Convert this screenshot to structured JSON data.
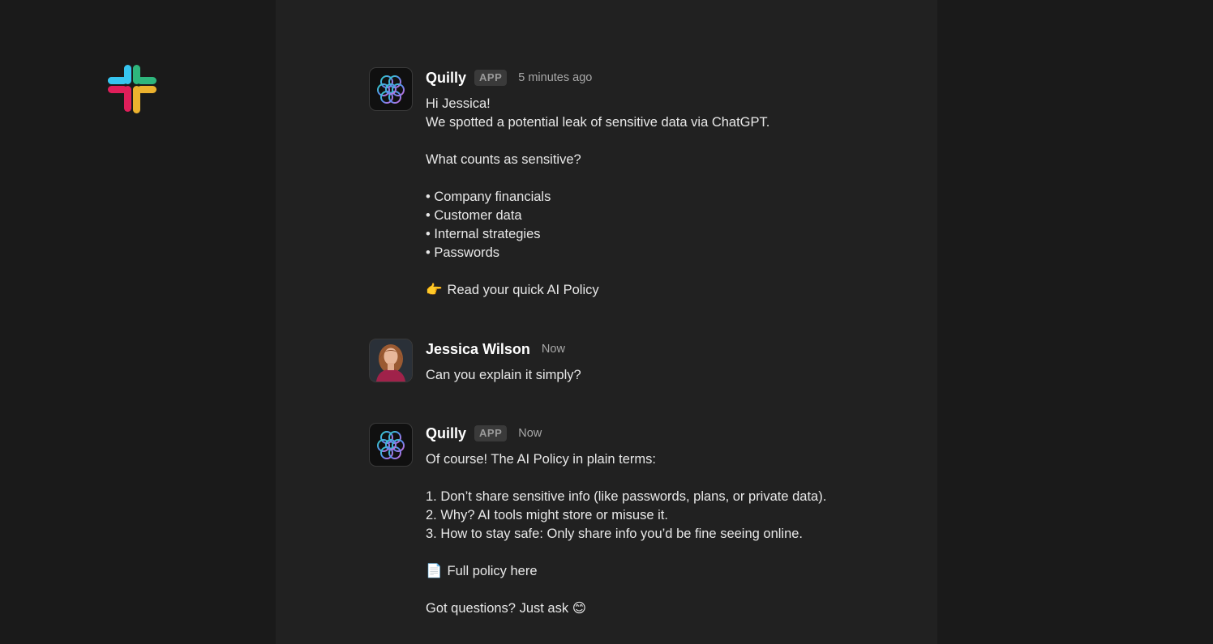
{
  "brand": {
    "logo": "slack-logo",
    "colors": {
      "blue": "#36c5f0",
      "green": "#2eb67d",
      "yellow": "#ecb22e",
      "red": "#e01e5a"
    }
  },
  "messages": [
    {
      "sender": "Quilly",
      "badge": "APP",
      "time": "5 minutes ago",
      "avatar": "quilly-logo",
      "lines": {
        "l1": "Hi Jessica!",
        "l2": "We spotted a potential leak of sensitive data via ChatGPT.",
        "l3": "What counts as sensitive?",
        "l4": "• Company financials",
        "l5": "• Customer data",
        "l6": "• Internal strategies",
        "l7": "• Passwords",
        "l8_emoji": "👉",
        "l8_text": "Read your quick AI Policy"
      }
    },
    {
      "sender": "Jessica Wilson",
      "time": "Now",
      "avatar": "user-photo",
      "lines": {
        "l1": "Can you explain it simply?"
      }
    },
    {
      "sender": "Quilly",
      "badge": "APP",
      "time": "Now",
      "avatar": "quilly-logo",
      "lines": {
        "l1": "Of course! The AI Policy in plain terms:",
        "l2": "1. Don’t share sensitive info (like passwords, plans, or private data).",
        "l3": "2. Why? AI tools might store or misuse it.",
        "l4": "3. How to stay safe: Only share info you’d be fine seeing online.",
        "l5_emoji": "📄",
        "l5_text": "Full policy here",
        "l6_text": "Got questions? Just ask",
        "l6_emoji": "😊"
      }
    }
  ]
}
